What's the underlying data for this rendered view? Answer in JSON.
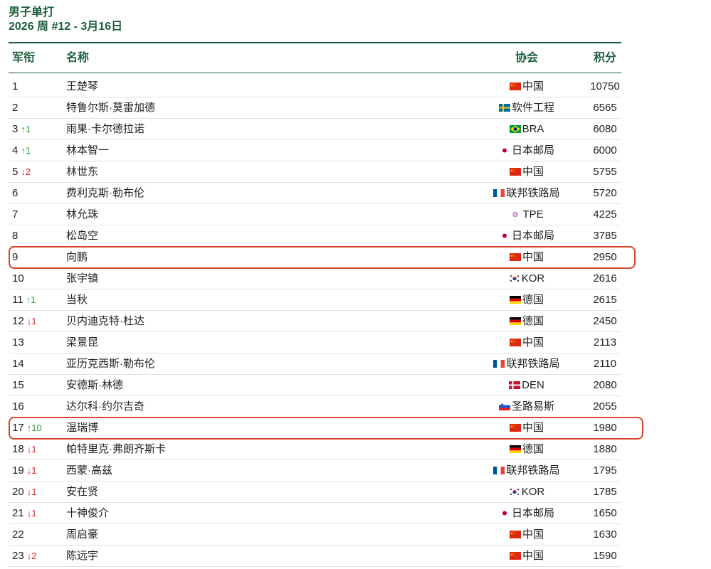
{
  "page": {
    "title": "男子单打",
    "subtitle": "2026 周 #12 - 3月16日"
  },
  "table": {
    "headers": {
      "rank": "军衔",
      "name": "名称",
      "association": "协会",
      "points": "积分"
    },
    "rows": [
      {
        "rank": "1",
        "change": "",
        "name": "王楚琴",
        "flag_icon": "china-flag",
        "association": "中国",
        "points": "10750",
        "highlighted": false
      },
      {
        "rank": "2",
        "change": "",
        "name": "特鲁尔斯·莫雷加德",
        "flag_icon": "sweden-flag",
        "association": "软件工程",
        "points": "6565",
        "highlighted": false
      },
      {
        "rank": "3",
        "change": "↑1",
        "name": "雨果·卡尔德拉诺",
        "flag_icon": "brazil-flag",
        "association": "BRA",
        "points": "6080",
        "highlighted": false
      },
      {
        "rank": "4",
        "change": "↑1",
        "name": "林本智一",
        "flag_icon": "japan-flag",
        "association": "日本邮局",
        "points": "6000",
        "highlighted": false
      },
      {
        "rank": "5",
        "change": "↓2",
        "name": "林世东",
        "flag_icon": "china-flag",
        "association": "中国",
        "points": "5755",
        "highlighted": false
      },
      {
        "rank": "6",
        "change": "",
        "name": "费利克斯·勒布伦",
        "flag_icon": "france-flag",
        "association": "联邦铁路局",
        "points": "5720",
        "highlighted": false
      },
      {
        "rank": "7",
        "change": "",
        "name": "林允珠",
        "flag_icon": "plum-blossom",
        "association": "TPE",
        "points": "4225",
        "highlighted": false
      },
      {
        "rank": "8",
        "change": "",
        "name": "松岛空",
        "flag_icon": "japan-flag",
        "association": "日本邮局",
        "points": "3785",
        "highlighted": false
      },
      {
        "rank": "9",
        "change": "",
        "name": "向鹏",
        "flag_icon": "china-flag",
        "association": "中国",
        "points": "2950",
        "highlighted": true
      },
      {
        "rank": "10",
        "change": "",
        "name": "张宇镇",
        "flag_icon": "korea-flag",
        "association": "KOR",
        "points": "2616",
        "highlighted": false
      },
      {
        "rank": "11",
        "change": "↑1",
        "name": "当秋",
        "flag_icon": "germany-flag",
        "association": "德国",
        "points": "2615",
        "highlighted": false
      },
      {
        "rank": "12",
        "change": "↓1",
        "name": "贝内迪克特·杜达",
        "flag_icon": "germany-flag",
        "association": "德国",
        "points": "2450",
        "highlighted": false
      },
      {
        "rank": "13",
        "change": "",
        "name": "梁景昆",
        "flag_icon": "china-flag",
        "association": "中国",
        "points": "2113",
        "highlighted": false
      },
      {
        "rank": "14",
        "change": "",
        "name": "亚历克西斯·勒布伦",
        "flag_icon": "france-flag",
        "association": "联邦铁路局",
        "points": "2110",
        "highlighted": false
      },
      {
        "rank": "15",
        "change": "",
        "name": "安德斯·林德",
        "flag_icon": "denmark-flag",
        "association": "DEN",
        "points": "2080",
        "highlighted": false
      },
      {
        "rank": "16",
        "change": "",
        "name": "达尔科·约尔吉奇",
        "flag_icon": "slovenia-flag",
        "association": "圣路易斯",
        "points": "2055",
        "highlighted": false
      },
      {
        "rank": "17",
        "change": "↑10",
        "name": "温瑞博",
        "flag_icon": "china-flag",
        "association": "中国",
        "points": "1980",
        "highlighted": true
      },
      {
        "rank": "18",
        "change": "↓1",
        "name": "帕特里克·弗朗齐斯卡",
        "flag_icon": "germany-flag",
        "association": "德国",
        "points": "1880",
        "highlighted": false
      },
      {
        "rank": "19",
        "change": "↓1",
        "name": "西蒙·高兹",
        "flag_icon": "france-flag",
        "association": "联邦铁路局",
        "points": "1795",
        "highlighted": false
      },
      {
        "rank": "20",
        "change": "↓1",
        "name": "安在贤",
        "flag_icon": "korea-flag",
        "association": "KOR",
        "points": "1785",
        "highlighted": false
      },
      {
        "rank": "21",
        "change": "↓1",
        "name": "十神俊介",
        "flag_icon": "japan-flag",
        "association": "日本邮局",
        "points": "1650",
        "highlighted": false
      },
      {
        "rank": "22",
        "change": "",
        "name": "周启豪",
        "flag_icon": "china-flag",
        "association": "中国",
        "points": "1630",
        "highlighted": false
      },
      {
        "rank": "23",
        "change": "↓2",
        "name": "陈远宇",
        "flag_icon": "china-flag",
        "association": "中国",
        "points": "1590",
        "highlighted": false
      }
    ]
  },
  "colors": {
    "accent": "#1b5e3b",
    "up": "#2e9e3e",
    "down": "#e02020",
    "highlight": "#d4472c",
    "row_divider": "#e2e2e2"
  }
}
